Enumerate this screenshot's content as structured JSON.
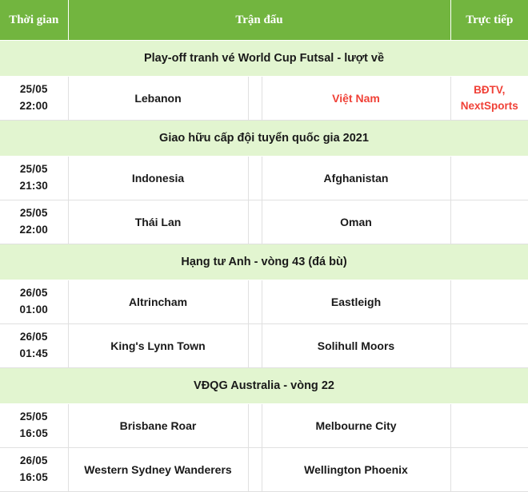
{
  "header": {
    "time_label": "Thời gian",
    "match_label": "Trận đấu",
    "tv_label": "Trực tiếp"
  },
  "colors": {
    "header_green": "#72b53f",
    "band_green": "#e2f5d0",
    "accent_red": "#f04137",
    "text_dark": "#1a1a1a",
    "border_gray": "#e0e0e0"
  },
  "sections": [
    {
      "title": "Play-off tranh vé World Cup Futsal - lượt về",
      "matches": [
        {
          "date": "25/05",
          "clock": "22:00",
          "home": "Lebanon",
          "away": "Việt Nam",
          "home_style": "normal",
          "away_style": "red",
          "tv": [
            "BĐTV,",
            "NextSports"
          ]
        }
      ]
    },
    {
      "title": "Giao hữu cấp đội tuyển quốc gia 2021",
      "matches": [
        {
          "date": "25/05",
          "clock": "21:30",
          "home": "Indonesia",
          "away": "Afghanistan",
          "home_style": "normal",
          "away_style": "normal",
          "tv": []
        },
        {
          "date": "25/05",
          "clock": "22:00",
          "home": "Thái Lan",
          "away": "Oman",
          "home_style": "normal",
          "away_style": "normal",
          "tv": []
        }
      ]
    },
    {
      "title": "Hạng tư Anh - vòng 43 (đá bù)",
      "matches": [
        {
          "date": "26/05",
          "clock": "01:00",
          "home": "Altrincham",
          "away": "Eastleigh",
          "home_style": "normal",
          "away_style": "plain",
          "tv": []
        },
        {
          "date": "26/05",
          "clock": "01:45",
          "home": "King's Lynn Town",
          "away": "Solihull Moors",
          "home_style": "normal",
          "away_style": "normal",
          "tv": []
        }
      ]
    },
    {
      "title": "VĐQG Australia - vòng 22",
      "matches": [
        {
          "date": "25/05",
          "clock": "16:05",
          "home": "Brisbane Roar",
          "away": "Melbourne City",
          "home_style": "normal",
          "away_style": "normal",
          "tv": []
        },
        {
          "date": "26/05",
          "clock": "16:05",
          "home": "Western Sydney Wanderers",
          "away": "Wellington Phoenix",
          "home_style": "normal",
          "away_style": "normal",
          "tv": []
        }
      ]
    }
  ]
}
